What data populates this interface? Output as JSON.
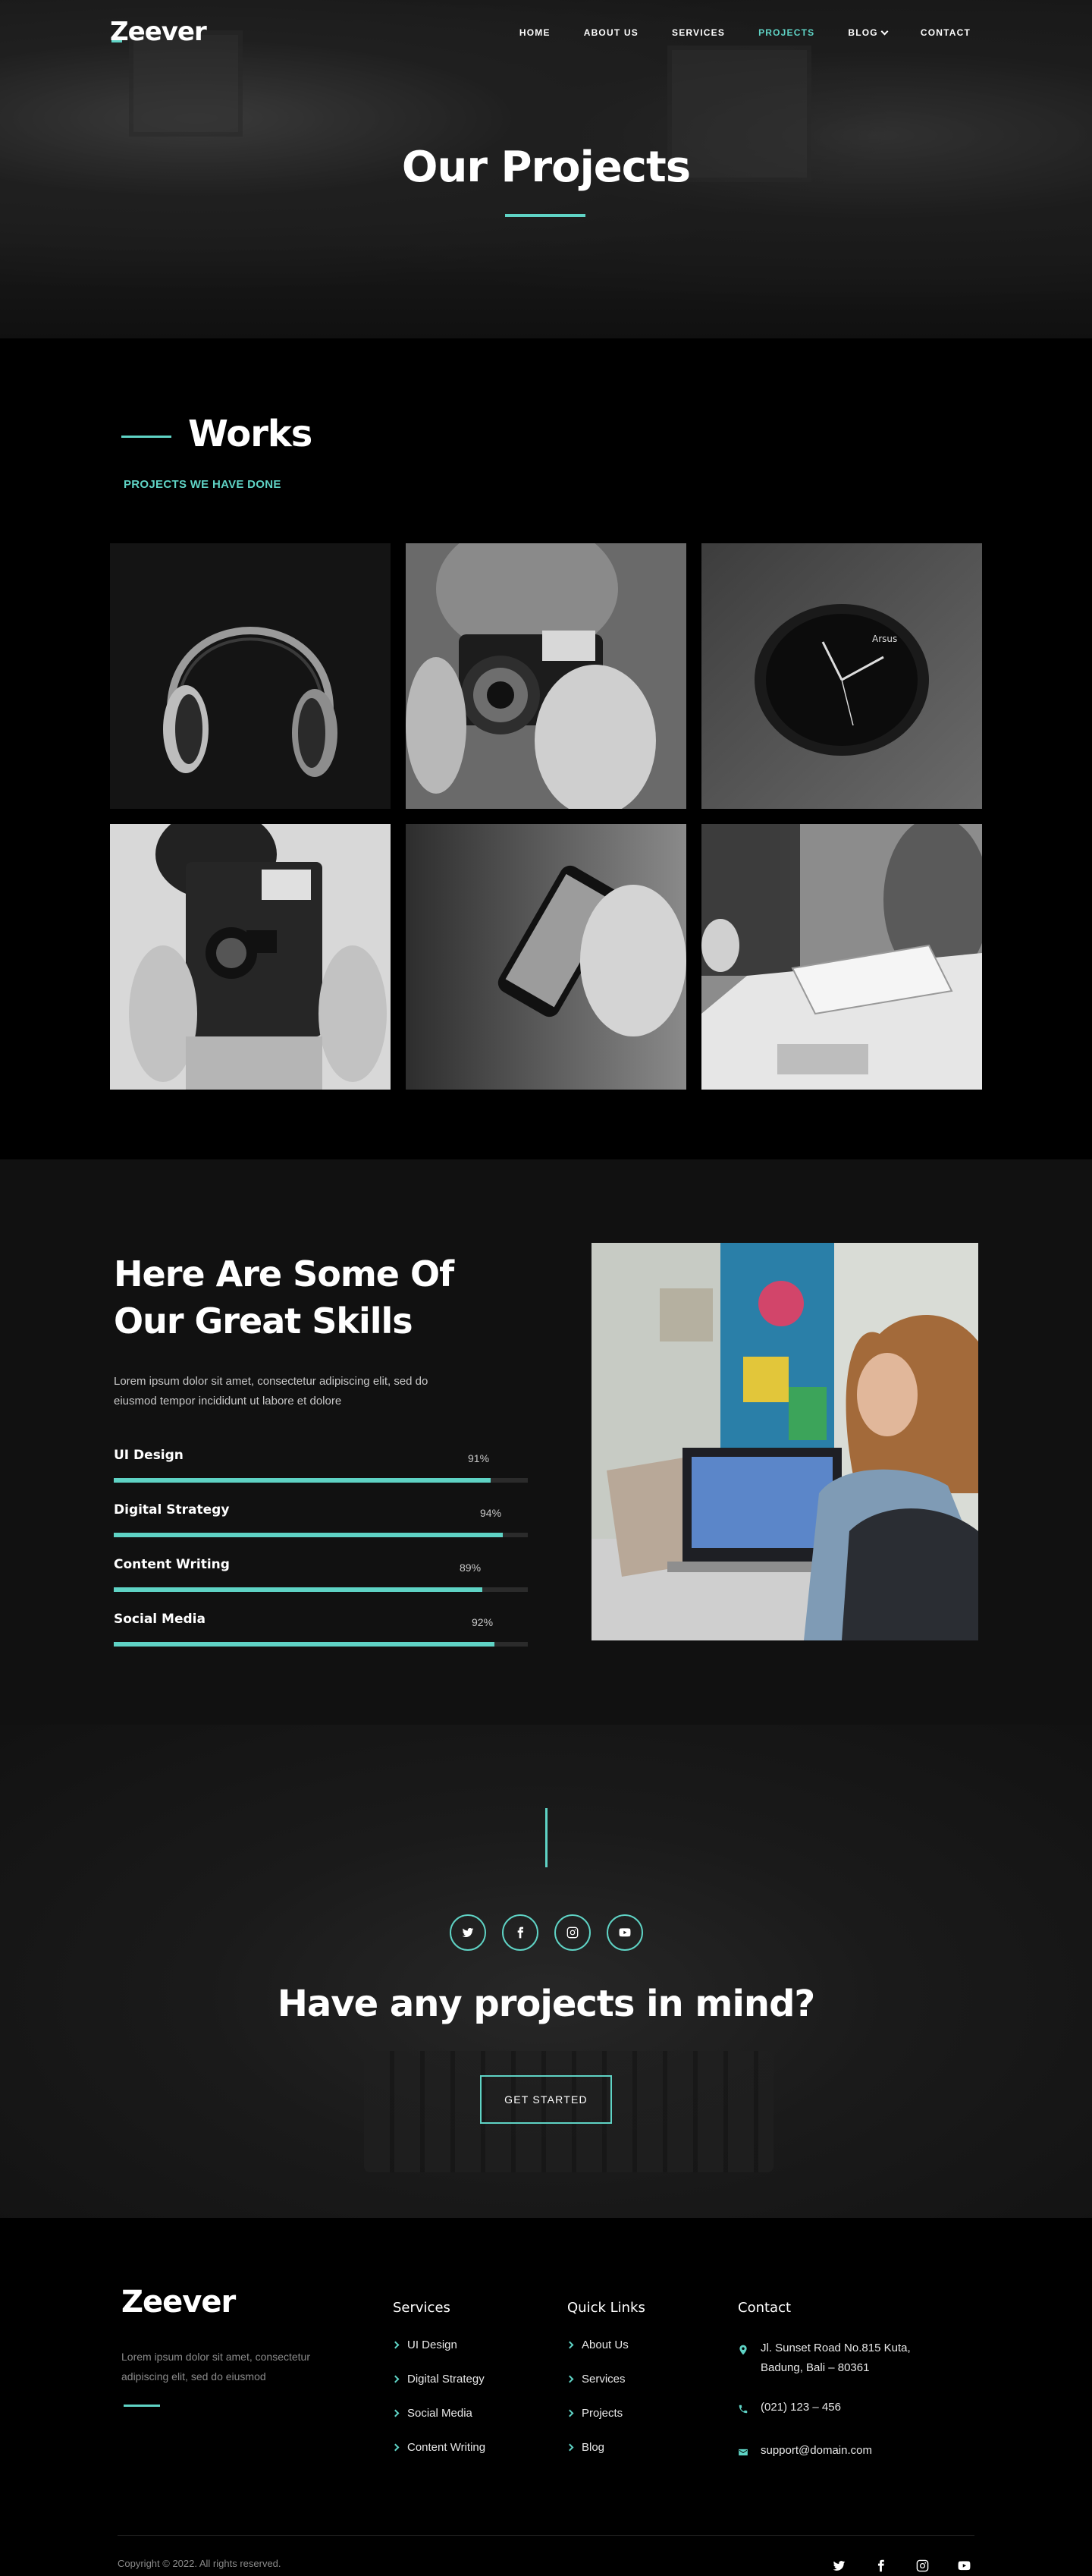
{
  "brand": {
    "name": "Zeever",
    "accent": "#5fd3c5"
  },
  "nav": {
    "items": [
      {
        "label": "HOME"
      },
      {
        "label": "ABOUT US"
      },
      {
        "label": "SERVICES"
      },
      {
        "label": "PROJECTS",
        "active": true
      },
      {
        "label": "BLOG",
        "dropdown": true
      },
      {
        "label": "CONTACT"
      }
    ]
  },
  "hero": {
    "title": "Our Projects"
  },
  "works": {
    "title": "Works",
    "subtitle": "PROJECTS WE HAVE DONE",
    "tiles": [
      {
        "icon": "headphones"
      },
      {
        "icon": "camera"
      },
      {
        "icon": "watch"
      },
      {
        "icon": "instant-camera"
      },
      {
        "icon": "smartphone"
      },
      {
        "icon": "notebook-desk"
      }
    ]
  },
  "skills": {
    "title_line1": "Here Are Some Of",
    "title_line2": "Our Great Skills",
    "description": "Lorem ipsum dolor sit amet, consectetur adipiscing elit, sed do eiusmod tempor incididunt ut labore et dolore",
    "items": [
      {
        "name": "UI Design",
        "percent": 91,
        "label": "91%"
      },
      {
        "name": "Digital Strategy",
        "percent": 94,
        "label": "94%"
      },
      {
        "name": "Content Writing",
        "percent": 89,
        "label": "89%"
      },
      {
        "name": "Social Media",
        "percent": 92,
        "label": "92%"
      }
    ]
  },
  "cta": {
    "socials": [
      "twitter-icon",
      "facebook-icon",
      "instagram-icon",
      "youtube-icon"
    ],
    "title": "Have any projects in mind?",
    "button": "GET STARTED"
  },
  "footer": {
    "logo": "Zeever",
    "description": "Lorem ipsum dolor sit amet, consectetur adipiscing elit, sed do eiusmod",
    "services": {
      "title": "Services",
      "items": [
        "UI Design",
        "Digital Strategy",
        "Social Media",
        "Content Writing"
      ]
    },
    "quick_links": {
      "title": "Quick Links",
      "items": [
        "About Us",
        "Services",
        "Projects",
        "Blog"
      ]
    },
    "contact": {
      "title": "Contact",
      "address": "Jl. Sunset Road No.815 Kuta, Badung, Bali – 80361",
      "phone": "(021) 123 – 456",
      "email": "support@domain.com"
    },
    "copyright": "Copyright © 2022. All rights reserved.",
    "socials": [
      "twitter-icon",
      "facebook-icon",
      "instagram-icon",
      "youtube-icon"
    ]
  }
}
